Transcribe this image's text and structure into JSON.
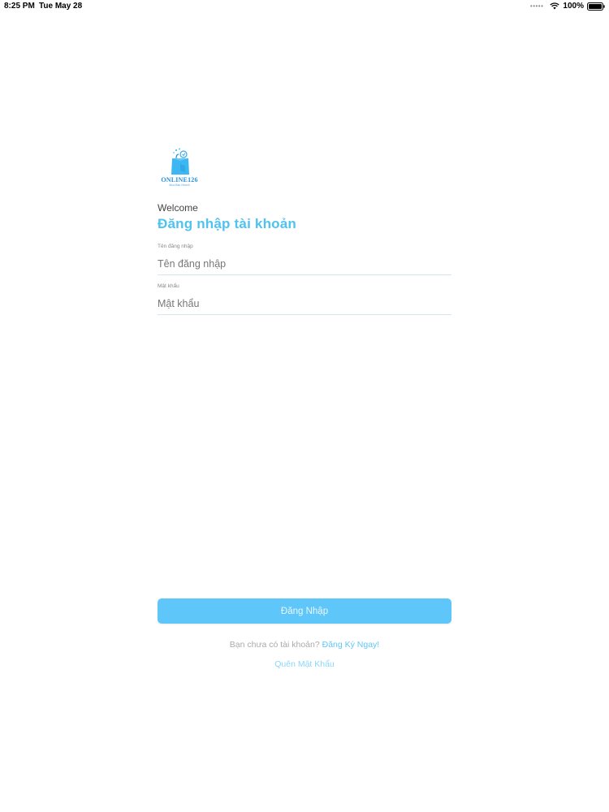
{
  "status_bar": {
    "time": "8:25 PM",
    "date": "Tue May 28",
    "battery": "100%",
    "icons": [
      "signal-dots-icon",
      "wifi-icon",
      "battery-icon"
    ]
  },
  "logo": {
    "text": "ONLINE126",
    "tagline": "Mua Bán Nhanh"
  },
  "header": {
    "welcome": "Welcome",
    "title": "Đăng nhập tài khoản"
  },
  "form": {
    "username": {
      "label": "Tên đăng nhập",
      "placeholder": "Tên đăng nhập",
      "value": ""
    },
    "password": {
      "label": "Mật khẩu",
      "placeholder": "Mật khẩu",
      "value": ""
    },
    "submit_label": "Đăng Nhập"
  },
  "footer": {
    "signup_prompt": "Bạn chưa có tài khoản?",
    "signup_link": "Đăng Ký Ngay!",
    "forgot_password": "Quên Mật Khẩu"
  },
  "colors": {
    "accent": "#4fc3f0",
    "button": "#5ec6f8",
    "underline": "#cfe8f5"
  }
}
